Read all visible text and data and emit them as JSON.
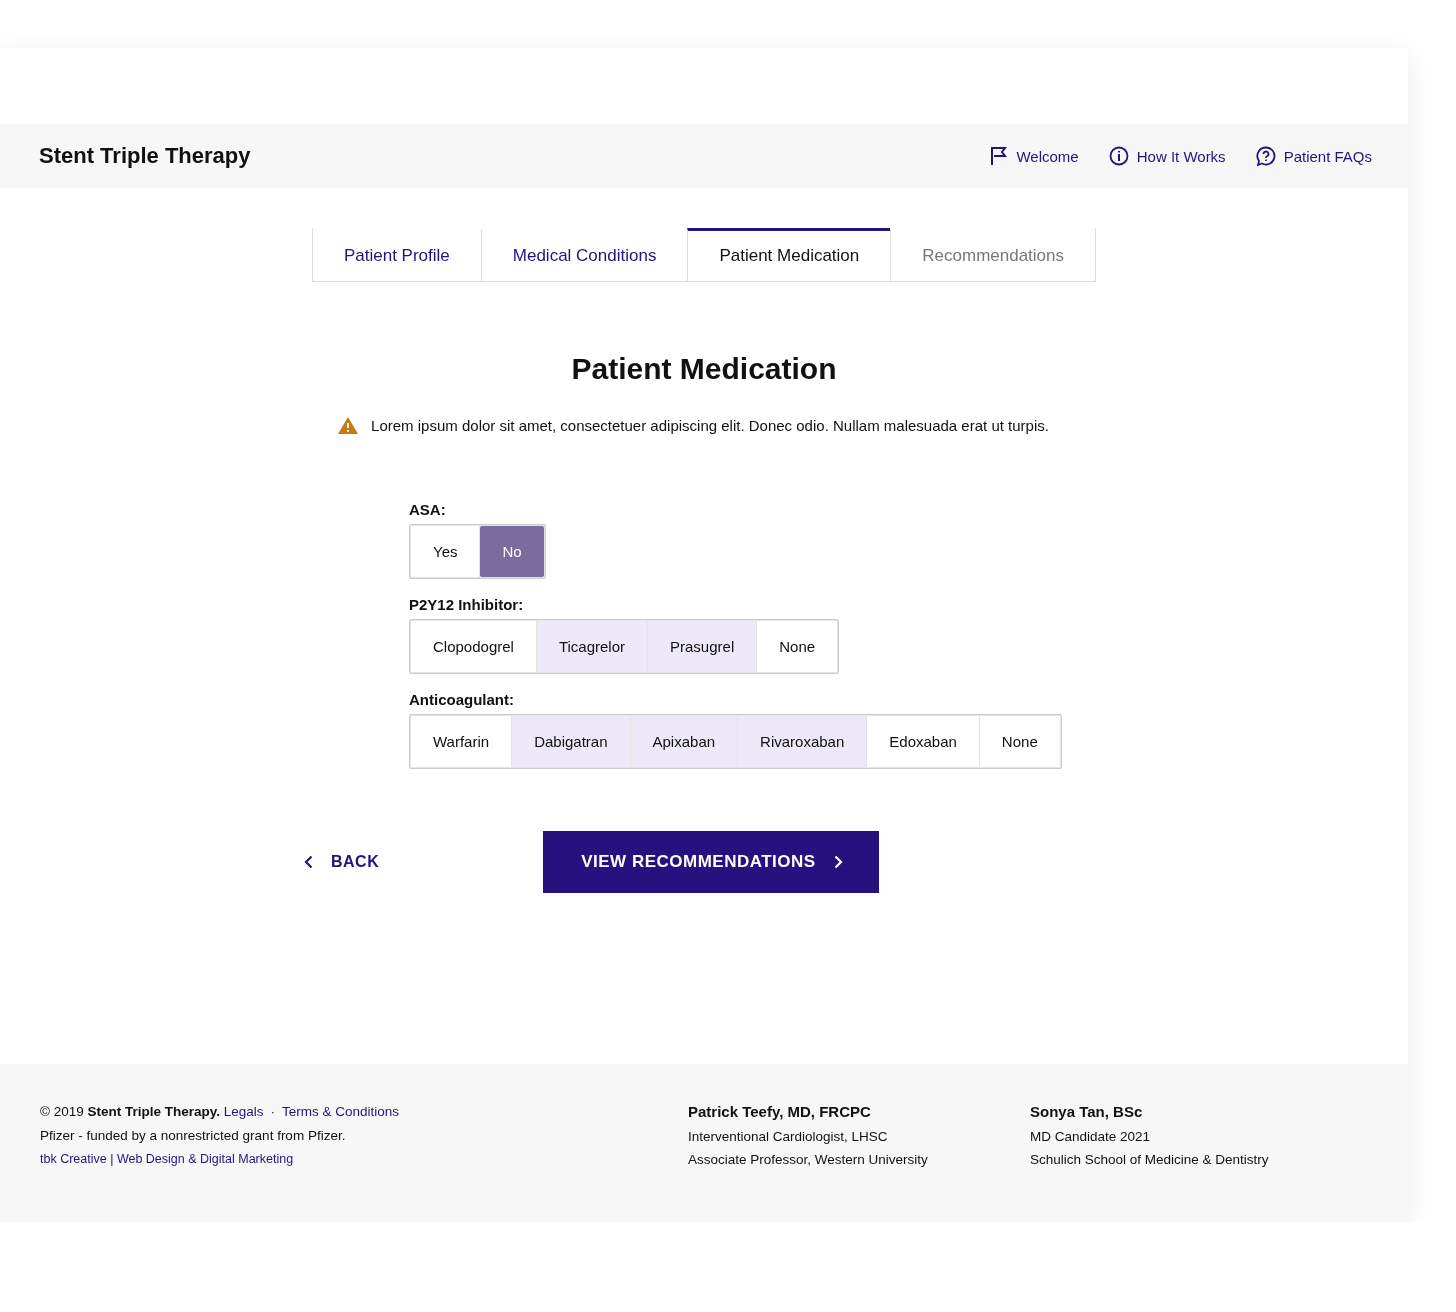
{
  "header": {
    "title": "Stent Triple Therapy",
    "nav": [
      {
        "kind": "flag",
        "label": "Welcome"
      },
      {
        "kind": "info",
        "label": "How It Works"
      },
      {
        "kind": "help",
        "label": "Patient FAQs"
      }
    ]
  },
  "tabs": [
    {
      "label": "Patient Profile",
      "selected": false,
      "disabled": false
    },
    {
      "label": "Medical Conditions",
      "selected": false,
      "disabled": false
    },
    {
      "label": "Patient Medication",
      "selected": true,
      "disabled": false
    },
    {
      "label": "Recommendations",
      "selected": false,
      "disabled": true
    }
  ],
  "heading": "Patient Medication",
  "warning": "Lorem ipsum dolor sit amet, consectetuer adipiscing elit. Donec odio. Nullam malesuada erat ut turpis.",
  "groups": [
    {
      "label": "ASA:",
      "options": [
        {
          "label": "Yes",
          "selected": false,
          "highlighted": false
        },
        {
          "label": "No",
          "selected": true,
          "highlighted": false
        }
      ]
    },
    {
      "label": "P2Y12 Inhibitor:",
      "options": [
        {
          "label": "Clopodogrel",
          "selected": false,
          "highlighted": false
        },
        {
          "label": "Ticagrelor",
          "selected": false,
          "highlighted": true
        },
        {
          "label": "Prasugrel",
          "selected": false,
          "highlighted": true
        },
        {
          "label": "None",
          "selected": false,
          "highlighted": false
        }
      ]
    },
    {
      "label": "Anticoagulant:",
      "options": [
        {
          "label": "Warfarin",
          "selected": false,
          "highlighted": false
        },
        {
          "label": "Dabigatran",
          "selected": false,
          "highlighted": true
        },
        {
          "label": "Apixaban",
          "selected": false,
          "highlighted": true
        },
        {
          "label": "Rivaroxaban",
          "selected": false,
          "highlighted": true
        },
        {
          "label": "Edoxaban",
          "selected": false,
          "highlighted": false
        },
        {
          "label": "None",
          "selected": false,
          "highlighted": false
        }
      ]
    }
  ],
  "back": "BACK",
  "next": "VIEW RECOMMENDATIONS",
  "footer": {
    "copyright": "© 2019 **Stent Triple Therapy.**",
    "links": [
      "Legals",
      "Terms & Conditions"
    ],
    "separator": "·",
    "funding": "Pfizer - funded by a nonrestricted grant from Pfizer.",
    "credit": "tbk Creative | Web Design & Digital Marketing",
    "people": [
      {
        "name": "Patrick Teefy, MD, FRCPC",
        "lines": [
          "Interventional Cardiologist, LHSC",
          "Associate Professor, Western University"
        ]
      },
      {
        "name": "Sonya Tan, BSc",
        "lines": [
          "MD Candidate 2021",
          "Schulich School of Medicine & Dentistry"
        ]
      }
    ]
  }
}
